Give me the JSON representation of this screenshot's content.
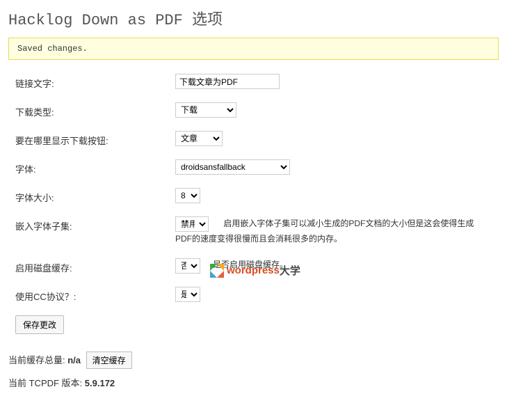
{
  "page_title": "Hacklog Down as PDF 选项",
  "notice": "Saved changes.",
  "fields": {
    "link_text": {
      "label": "链接文字:",
      "value": "下载文章为PDF"
    },
    "download_type": {
      "label": "下载类型:",
      "value": "下载"
    },
    "where_show": {
      "label": "要在哪里显示下载按钮:",
      "value": "文章"
    },
    "font": {
      "label": "字体:",
      "value": "droidsansfallback"
    },
    "font_size": {
      "label": "字体大小:",
      "value": "8"
    },
    "subset": {
      "label": "嵌入字体子集:",
      "value": "禁用",
      "desc": "启用嵌入字体子集可以减小生成的PDF文档的大小但是这会使得生成PDF的速度变得很慢而且会消耗很多的内存。"
    },
    "cache": {
      "label": "启用磁盘缓存:",
      "value": "否",
      "desc": "是否启用磁盘缓存。"
    },
    "cc": {
      "label": "使用CC协议？:",
      "value": "是"
    }
  },
  "buttons": {
    "save": "保存更改",
    "clear_cache": "清空缓存"
  },
  "info": {
    "cache_total_label": "当前缓存总量: ",
    "cache_total_value": "n/a",
    "tcpdf_label": "当前 TCPDF 版本: ",
    "tcpdf_value": "5.9.172"
  },
  "watermark": {
    "text1": "wordpress",
    "text2": "大学"
  }
}
